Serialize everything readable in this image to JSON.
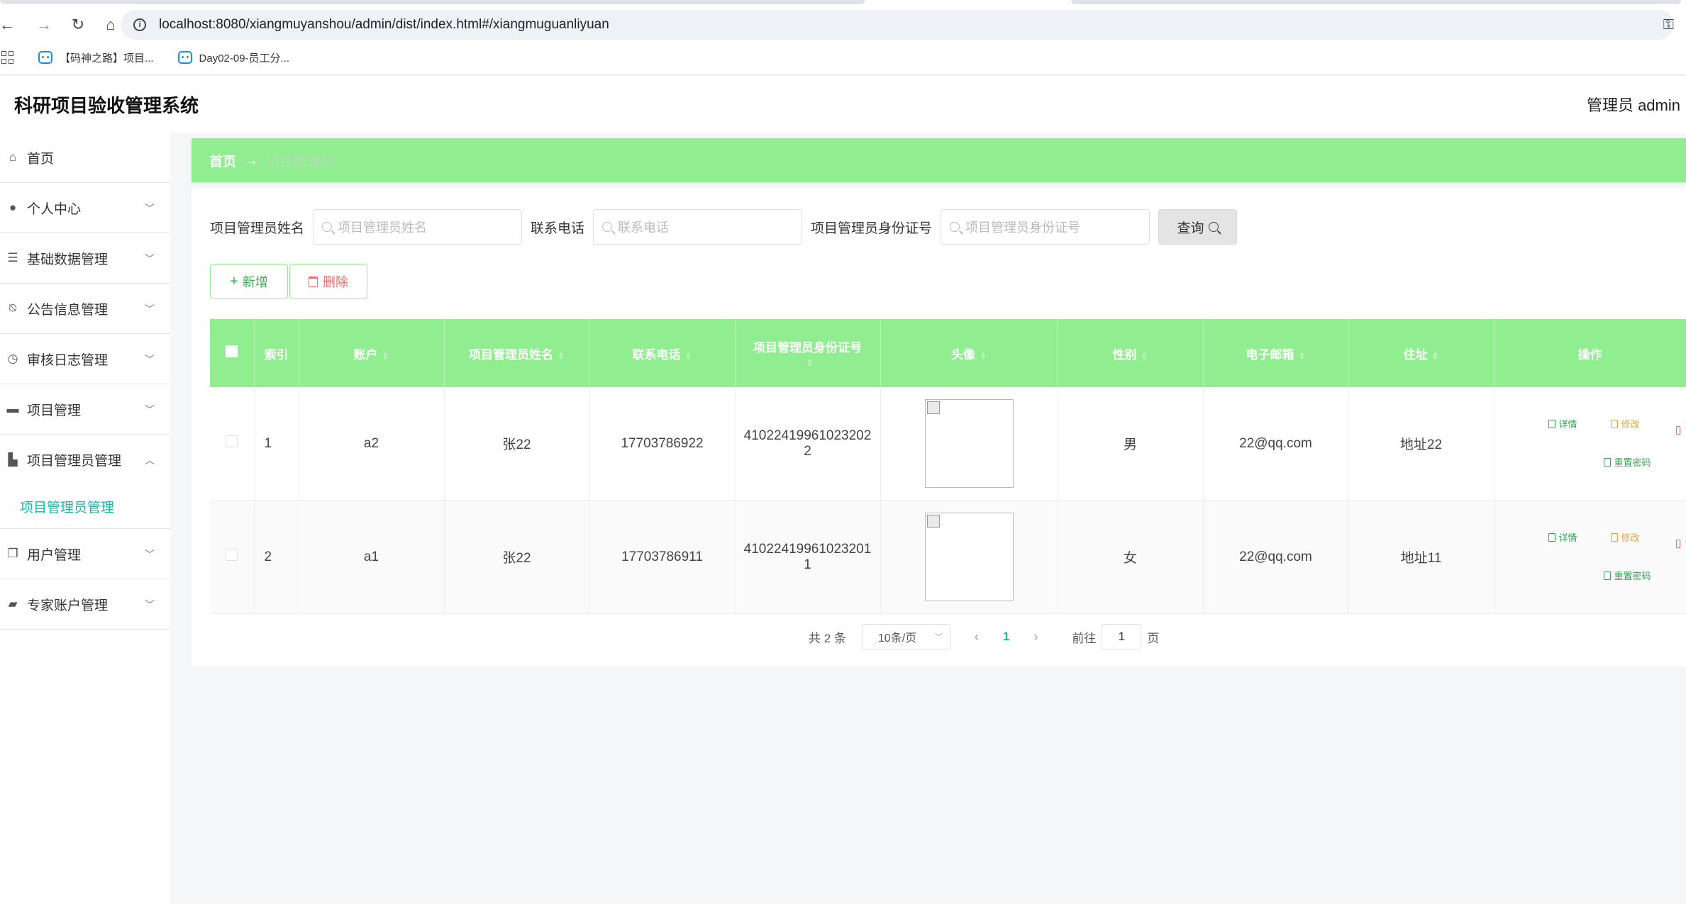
{
  "browser": {
    "url": "localhost:8080/xiangmuyanshou/admin/dist/index.html#/xiangmuguanliyuan",
    "bookmarks": [
      "【码神之路】项目...",
      "Day02-09-员工分..."
    ]
  },
  "header": {
    "title": "科研项目验收管理系统",
    "user": "管理员 admin"
  },
  "sidebar": {
    "items": [
      {
        "label": "首页",
        "icon": "home-icon"
      },
      {
        "label": "个人中心",
        "icon": "user-icon"
      },
      {
        "label": "基础数据管理",
        "icon": "list-icon"
      },
      {
        "label": "公告信息管理",
        "icon": "bell-off-icon"
      },
      {
        "label": "审核日志管理",
        "icon": "clock-icon"
      },
      {
        "label": "项目管理",
        "icon": "briefcase-icon"
      },
      {
        "label": "项目管理员管理",
        "icon": "stamp-icon"
      },
      {
        "label": "用户管理",
        "icon": "copy-icon"
      },
      {
        "label": "专家账户管理",
        "icon": "ticket-icon"
      }
    ],
    "submenu": "项目管理员管理"
  },
  "breadcrumb": {
    "home": "首页",
    "arrow": "→",
    "current": "项目管理员"
  },
  "search": {
    "name_label": "项目管理员姓名",
    "name_placeholder": "项目管理员姓名",
    "phone_label": "联系电话",
    "phone_placeholder": "联系电话",
    "id_label": "项目管理员身份证号",
    "id_placeholder": "项目管理员身份证号",
    "query_label": "查询"
  },
  "actions": {
    "add_label": "新增",
    "delete_label": "删除"
  },
  "table": {
    "columns": [
      "索引",
      "账户",
      "项目管理员姓名",
      "联系电话",
      "项目管理员身份证号",
      "头像",
      "性别",
      "电子邮箱",
      "住址",
      "操作"
    ],
    "rows": [
      {
        "index": "1",
        "account": "a2",
        "name": "张22",
        "phone": "17703786922",
        "id_line1": "41022419961023202",
        "id_line2": "2",
        "gender": "男",
        "email": "22@qq.com",
        "address": "地址22"
      },
      {
        "index": "2",
        "account": "a1",
        "name": "张22",
        "phone": "17703786911",
        "id_line1": "41022419961023201",
        "id_line2": "1",
        "gender": "女",
        "email": "22@qq.com",
        "address": "地址11"
      }
    ],
    "ops": {
      "detail": "详情",
      "edit": "修改",
      "delete": "删除",
      "reset": "重置密码"
    }
  },
  "pagination": {
    "total": "共 2 条",
    "page_size": "10条/页",
    "current": "1",
    "goto_label": "前往",
    "goto_value": "1",
    "page_suffix": "页"
  }
}
